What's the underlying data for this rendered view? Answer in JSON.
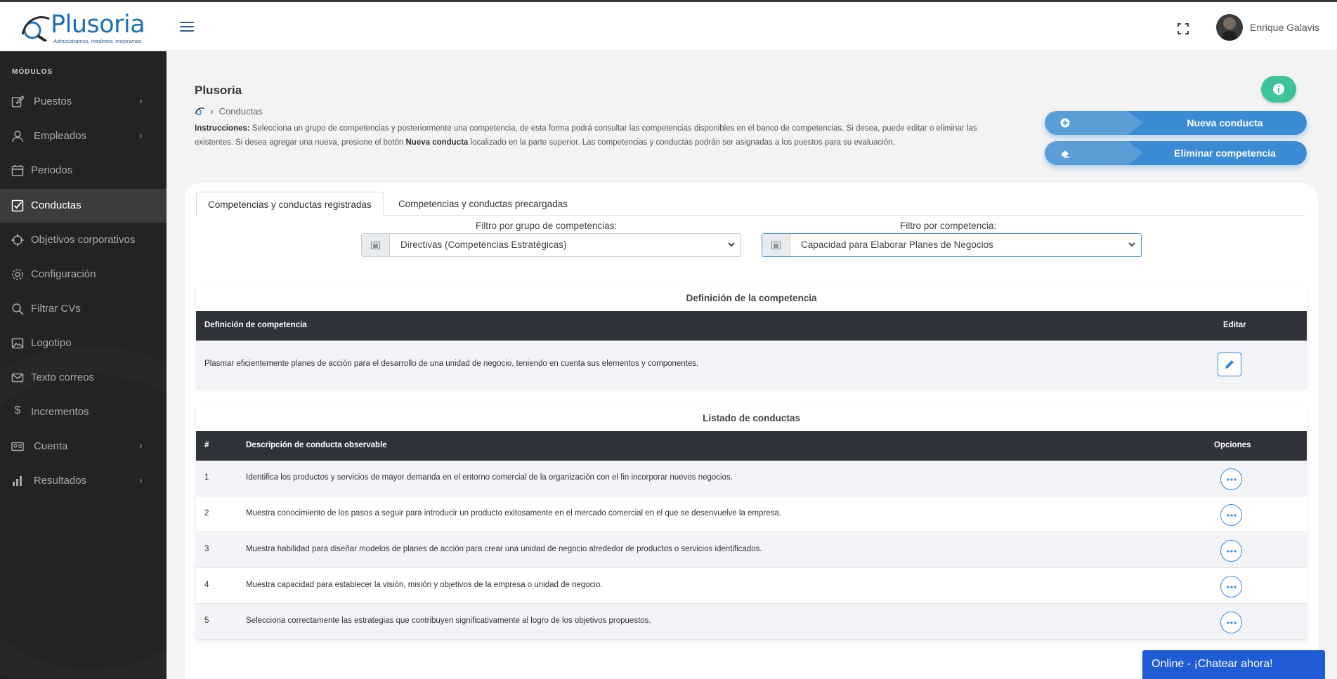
{
  "brand": {
    "name": "Plusoria",
    "tagline": "Administramos, medimos, mejoramos"
  },
  "user": {
    "name": "Enrique Galavis"
  },
  "sidebar": {
    "heading": "MÓDULOS",
    "items": [
      {
        "label": "Puestos",
        "icon": "edit-icon",
        "chevron": true
      },
      {
        "label": "Empleados",
        "icon": "user-icon",
        "chevron": true
      },
      {
        "label": "Periodos",
        "icon": "calendar-icon",
        "chevron": false
      },
      {
        "label": "Conductas",
        "icon": "checkbox-icon",
        "chevron": false,
        "active": true
      },
      {
        "label": "Objetivos corporativos",
        "icon": "crosshair-icon",
        "chevron": false
      },
      {
        "label": "Configuración",
        "icon": "gear-icon",
        "chevron": false
      },
      {
        "label": "Filtrar CVs",
        "icon": "search-icon",
        "chevron": false
      },
      {
        "label": "Logotipo",
        "icon": "image-icon",
        "chevron": false
      },
      {
        "label": "Texto correos",
        "icon": "mail-icon",
        "chevron": false
      },
      {
        "label": "Incrementos",
        "icon": "dollar-icon",
        "chevron": false
      },
      {
        "label": "Cuenta",
        "icon": "id-card-icon",
        "chevron": true
      },
      {
        "label": "Resultados",
        "icon": "bar-chart-icon",
        "chevron": true
      }
    ]
  },
  "page": {
    "title": "Plusoria",
    "breadcrumb": "Conductas",
    "instructions_label": "Instrucciones:",
    "instructions_part1": " Selecciona un grupo de competencias y posteriormente una competencia, de esta forma podrá consultar las competencias disponibles en el banco de competencias. Si desea, puede editar o eliminar las existentes. Si desea agregar una nueva, presione el botón ",
    "instructions_bold": "Nueva conducta",
    "instructions_part2": " localizado en la parte superior. Las competencias y conductas podrán ser asignadas a los puestos para su evaluación."
  },
  "actions": {
    "new_label": "Nueva conducta",
    "delete_label": "Eliminar competencia"
  },
  "tabs": [
    "Competencias y conductas registradas",
    "Competencias y conductas precargadas"
  ],
  "filters": {
    "group_label": "Filtro por grupo de competencias:",
    "group_value": "Directivas (Competencias Estratégicas)",
    "competency_label": "Filtro por competencia:",
    "competency_value": "Capacidad para Elaborar Planes de Negocios"
  },
  "definition": {
    "title": "Definición de la competencia",
    "col_definition": "Definición de competencia",
    "col_edit": "Editar",
    "text": "Plasmar eficientemente planes de acción para el desarrollo de una unidad de negocio, teniendo en cuenta sus elementos y componentes."
  },
  "conducts": {
    "title": "Listado de conductas",
    "col_num": "#",
    "col_desc": "Descripción de conducta observable",
    "col_options": "Opciones",
    "rows": [
      {
        "num": "1",
        "desc": "Identifica los productos y servicios de mayor demanda en el entorno comercial de la organización con el fin incorporar nuevos negocios."
      },
      {
        "num": "2",
        "desc": "Muestra conocimiento de los pasos a seguir para introducir un producto exitosamente en el mercado comercial en el que se desenvuelve la empresa."
      },
      {
        "num": "3",
        "desc": "Muestra habilidad para diseñar modelos de planes de acción para crear una unidad de negocio alrededor de productos o servicios identificados."
      },
      {
        "num": "4",
        "desc": "Muestra capacidad para establecer la visión, misión y objetivos de la empresa o unidad de negocio."
      },
      {
        "num": "5",
        "desc": "Selecciona correctamente las estrategias que contribuyen significativamente al logro de los objetivos propuestos."
      }
    ]
  },
  "chat": {
    "label": "Online - ¡Chatear ahora!"
  },
  "colors": {
    "sidebar_bg": "#232323",
    "accent_blue": "#3a8ad4",
    "brand_blue": "#1e6fb5",
    "table_header": "#2f3238",
    "info_green": "#3cc39a",
    "chat_blue": "#1e5bd4"
  }
}
